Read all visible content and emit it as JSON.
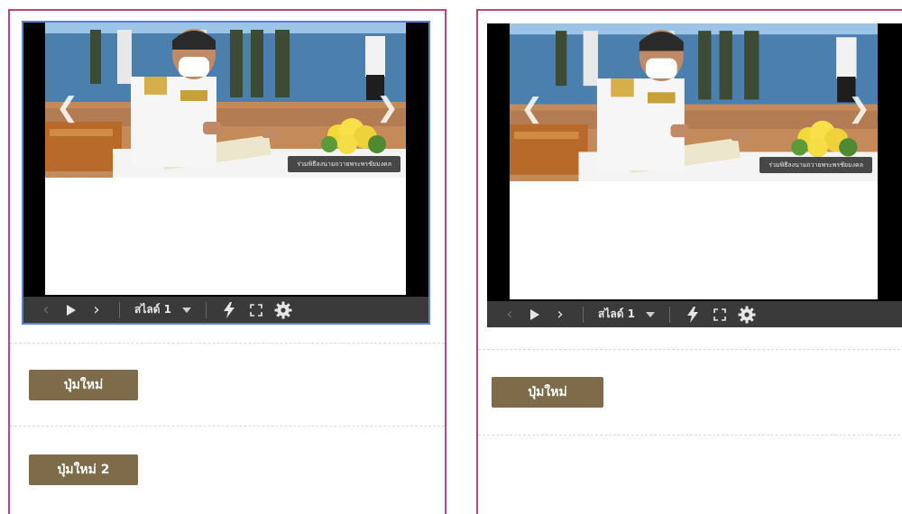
{
  "panels": [
    {
      "slide_caption": "ร่วมพิธีลงนามถวายพระพรชัยมงคล",
      "slide_selector": "สไลด์ 1",
      "buttons": [
        "ปุ่มใหม่",
        "ปุ่มใหม่ 2"
      ]
    },
    {
      "slide_caption": "ร่วมพิธีลงนามถวายพระพรชัยมงคล",
      "slide_selector": "สไลด์ 1",
      "buttons": [
        "ปุ่มใหม่"
      ]
    }
  ],
  "arrows": {
    "prev": "❮",
    "next": "❯"
  },
  "toolbar_icons": [
    "previous-icon",
    "play-icon",
    "next-icon",
    "dropdown-caret-icon",
    "laser-pointer-icon",
    "fullscreen-icon",
    "settings-gear-icon"
  ],
  "colors": {
    "panel_border": "#c2457a",
    "button_bg": "#7d6b49",
    "toolbar_bg": "#3a3a3a",
    "selection_outline": "#5f7ee0"
  }
}
